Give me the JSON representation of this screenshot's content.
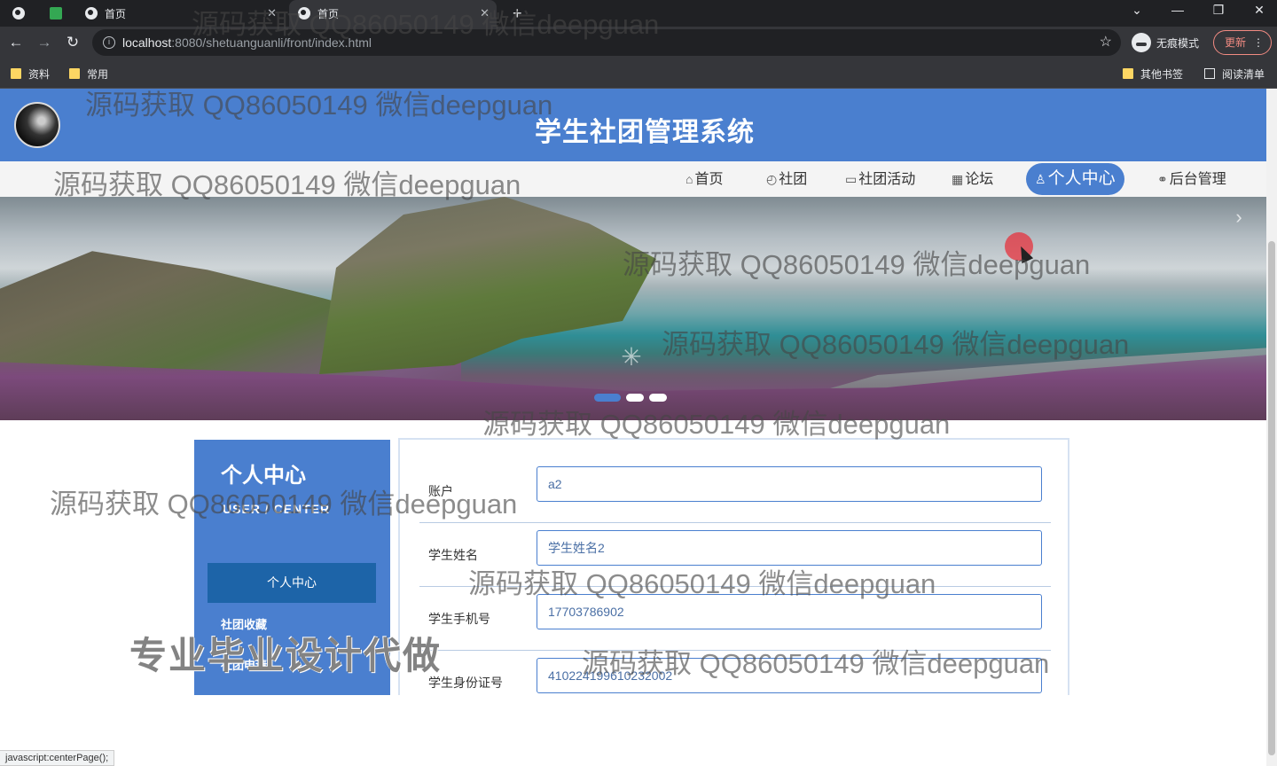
{
  "browser": {
    "tabs": [
      {
        "label": "首页"
      },
      {
        "label": "首页"
      }
    ],
    "new_tab_symbol": "+",
    "url_host": "localhost",
    "url_path": ":8080/shetuanguanli/front/index.html",
    "incognito_label": "无痕模式",
    "update_label": "更新",
    "bookmarks": [
      "资料",
      "常用"
    ],
    "bookmarks_right": [
      "其他书签",
      "阅读清单"
    ],
    "status_url": "javascript:centerPage();"
  },
  "site": {
    "title": "学生社团管理系统",
    "nav": [
      {
        "label": "首页",
        "icon": "home-icon"
      },
      {
        "label": "社团",
        "icon": "gauge-icon"
      },
      {
        "label": "社团活动",
        "icon": "book-icon"
      },
      {
        "label": "论坛",
        "icon": "grid-icon"
      },
      {
        "label": "个人中心",
        "icon": "user-icon"
      },
      {
        "label": "后台管理",
        "icon": "link-icon"
      }
    ],
    "accent_color": "#4a7fcf"
  },
  "banner": {
    "dots": 3,
    "active_dot": 0
  },
  "sidebar": {
    "title": "个人中心",
    "subtitle": "USER / CENTER",
    "items": [
      {
        "label": "个人中心"
      },
      {
        "label": "社团收藏"
      },
      {
        "label": "社团申请"
      }
    ]
  },
  "form": {
    "fields": [
      {
        "label": "账户",
        "value": "a2"
      },
      {
        "label": "学生姓名",
        "value": "学生姓名2"
      },
      {
        "label": "学生手机号",
        "value": "17703786902"
      },
      {
        "label": "学生身份证号",
        "value": "410224199610232002"
      }
    ]
  },
  "watermarks": {
    "repeat": "源码获取 QQ86050149 微信deepguan",
    "big": "专业毕业设计代做"
  }
}
